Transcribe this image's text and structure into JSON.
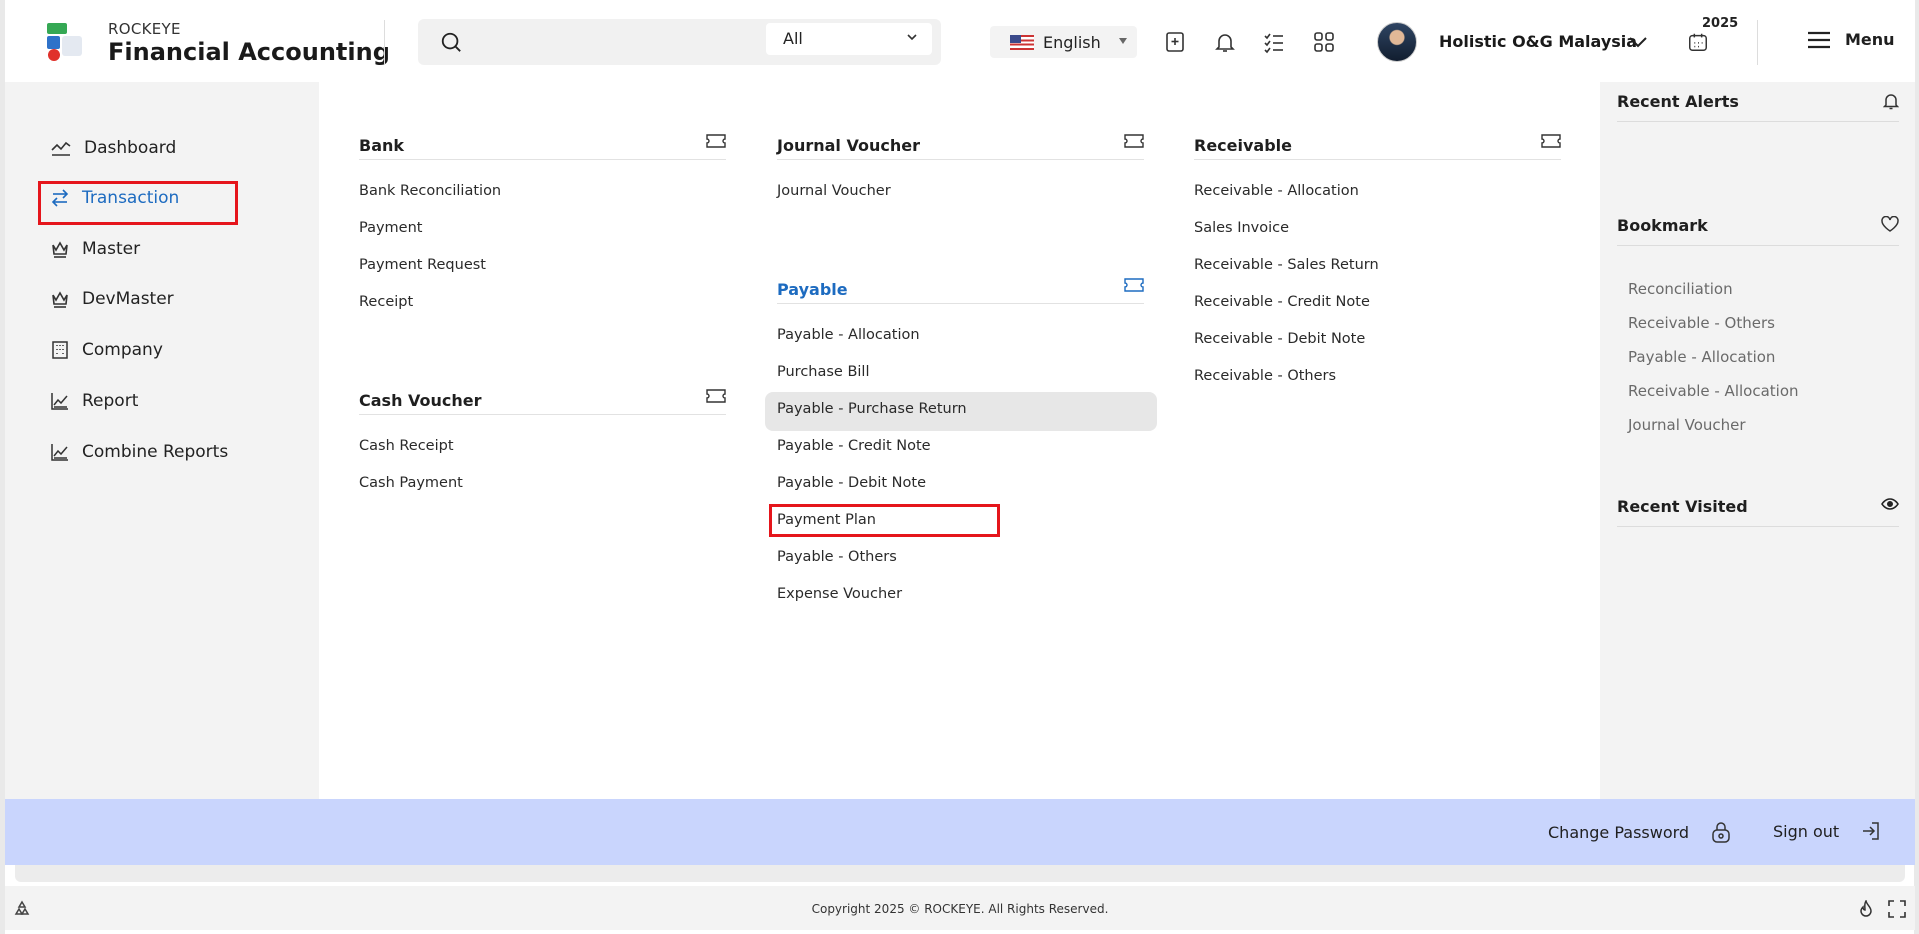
{
  "brand": {
    "small": "ROCKEYE",
    "big": "Financial Accounting"
  },
  "search": {
    "placeholder": "",
    "scope": "All"
  },
  "language": "English",
  "user": {
    "company": "Holistic O&G Malaysia",
    "year": "2025"
  },
  "menu_label": "Menu",
  "sidebar": {
    "items": [
      {
        "label": "Dashboard",
        "icon": "dashboard-icon"
      },
      {
        "label": "Transaction",
        "icon": "transaction-icon",
        "active": true
      },
      {
        "label": "Master",
        "icon": "crown-icon"
      },
      {
        "label": "DevMaster",
        "icon": "crown-icon"
      },
      {
        "label": "Company",
        "icon": "building-icon"
      },
      {
        "label": "Report",
        "icon": "report-icon"
      },
      {
        "label": "Combine Reports",
        "icon": "report-icon"
      }
    ]
  },
  "groups": {
    "bank": {
      "title": "Bank",
      "items": [
        "Bank Reconciliation",
        "Payment",
        "Payment Request",
        "Receipt"
      ]
    },
    "cash_voucher": {
      "title": "Cash Voucher",
      "items": [
        "Cash Receipt",
        "Cash Payment"
      ]
    },
    "journal_voucher": {
      "title": "Journal Voucher",
      "items": [
        "Journal Voucher"
      ]
    },
    "payable": {
      "title": "Payable",
      "items": [
        "Payable - Allocation",
        "Purchase Bill",
        "Payable - Purchase Return",
        "Payable - Credit Note",
        "Payable - Debit Note",
        "Payment Plan",
        "Payable - Others",
        "Expense Voucher"
      ]
    },
    "receivable": {
      "title": "Receivable",
      "items": [
        "Receivable - Allocation",
        "Sales Invoice",
        "Receivable - Sales Return",
        "Receivable - Credit Note",
        "Receivable - Debit Note",
        "Receivable - Others"
      ]
    }
  },
  "right_panel": {
    "recent_alerts": "Recent Alerts",
    "bookmark": "Bookmark",
    "bookmarks": [
      "Reconciliation",
      "Receivable - Others",
      "Payable - Allocation",
      "Receivable - Allocation",
      "Journal Voucher"
    ],
    "recent_visited": "Recent Visited"
  },
  "bottom": {
    "change_password": "Change Password",
    "sign_out": "Sign out"
  },
  "footer": {
    "copyright": "Copyright 2025 © ROCKEYE. All Rights Reserved."
  },
  "colors": {
    "accent": "#1d6bc0",
    "highlight": "#e5151b",
    "bluebar": "#c9d5fd"
  }
}
